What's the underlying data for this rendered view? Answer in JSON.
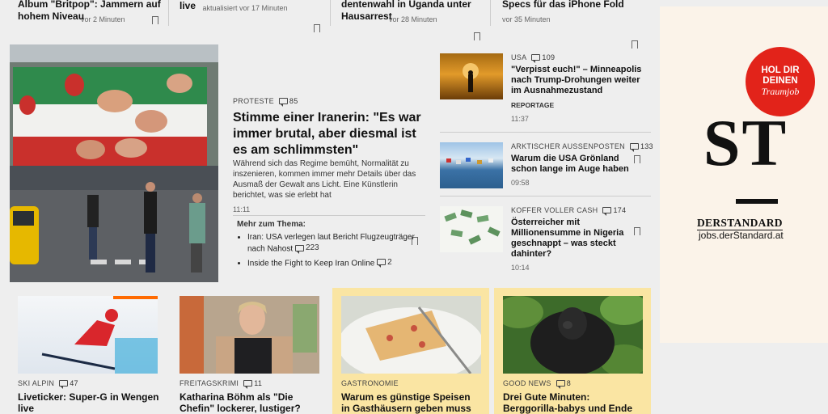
{
  "top_row": [
    {
      "title": "Album \"Britpop\": Jammern auf hohem Niveau",
      "time": "vor 2 Minuten"
    },
    {
      "title": "live",
      "time": "aktualisiert vor 17 Minuten"
    },
    {
      "title": "dentenwahl in Uganda unter Hausarrest",
      "time": "vor 28 Minuten"
    },
    {
      "title": "Specs für das iPhone Fold",
      "time": "vor 35 Minuten"
    }
  ],
  "main": {
    "kicker": "PROTESTE",
    "comments": "85",
    "title": "Stimme einer Iranerin: \"Es war immer brutal, aber diesmal ist es am schlimmsten\"",
    "teaser": "Während sich das Regime bemüht, Normalität zu inszenieren, kommen immer mehr Details über das Ausmaß der Gewalt ans Licht. Eine Künstlerin berichtet, was sie erlebt hat",
    "time": "11:11",
    "more_label": "Mehr zum Thema:",
    "more": [
      {
        "text": "Iran: USA verlegen laut Bericht Flugzeugträger nach Nahost",
        "comments": "223"
      },
      {
        "text": "Inside the Fight to Keep Iran Online",
        "comments": "2"
      }
    ]
  },
  "side_list": [
    {
      "kicker": "USA",
      "comments": "109",
      "title": "\"Verpisst euch!\" – Minneapolis nach Trump-Drohungen weiter im Ausnahmezustand",
      "tag": "REPORTAGE",
      "time": "11:37"
    },
    {
      "kicker": "ARKTISCHER AUSSENPOSTEN",
      "comments": "133",
      "title": "Warum die USA Grönland schon lange im Auge haben",
      "time": "09:58"
    },
    {
      "kicker": "KOFFER VOLLER CASH",
      "comments": "174",
      "title": "Österreicher mit Millionensumme in Nigeria geschnappt – was steckt dahinter?",
      "time": "10:14"
    }
  ],
  "bottom_row": [
    {
      "kicker": "SKI ALPIN",
      "comments": "47",
      "title": "Liveticker: Super-G in Wengen live"
    },
    {
      "kicker": "FREITAGSKRIMI",
      "comments": "11",
      "title": "Katharina Böhm als \"Die Chefin\" lockerer, lustiger? \"Kein Mann"
    },
    {
      "kicker": "GASTRONOMIE",
      "comments": "",
      "title": "Warum es günstige Speisen in Gasthäusern geben muss"
    },
    {
      "kicker": "GOOD NEWS",
      "comments": "8",
      "title": "Drei Gute Minuten: Berggorilla-babys und Ende für \"Tampon"
    }
  ],
  "ad": {
    "circle_line1": "HOL DIR",
    "circle_line2": "DEINEN",
    "circle_line3": "Traumjob",
    "logo_letters": "ST",
    "brand": "DERSTANDARD",
    "url": "jobs.derStandard.at"
  },
  "colors": {
    "accent_yellow": "#fae5a3",
    "ad_bg": "#fbf3e9",
    "ad_red": "#e2231a",
    "background": "#eeeeee"
  }
}
